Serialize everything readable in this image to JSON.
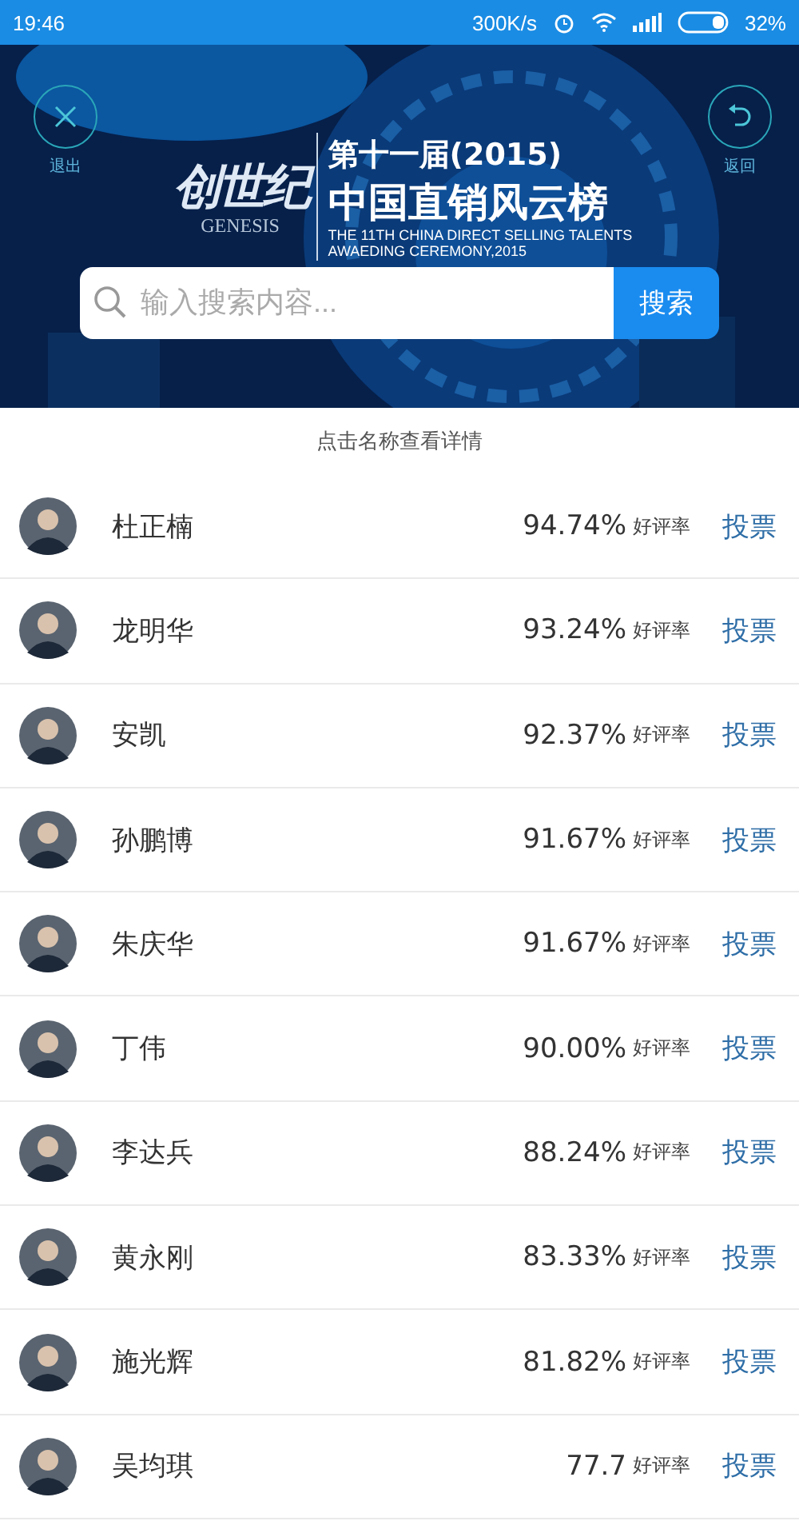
{
  "status_bar": {
    "time": "19:46",
    "speed": "300K/s",
    "battery": "32%"
  },
  "banner": {
    "exit_label": "退出",
    "back_label": "返回",
    "logo_cn": "创世纪",
    "logo_en": "GENESIS",
    "edition": "第十一届(2015)",
    "title": "中国直销风云榜",
    "subtitle_1": "THE 11TH CHINA DIRECT SELLING TALENTS",
    "subtitle_2": "AWAEDING CEREMONY,2015",
    "search": {
      "placeholder": "输入搜索内容...",
      "button": "搜索"
    }
  },
  "hint": "点击名称查看详情",
  "rows": [
    {
      "name": "杜正楠",
      "rate": "94.74%",
      "rate_label": "好评率",
      "vote": "投票"
    },
    {
      "name": "龙明华",
      "rate": "93.24%",
      "rate_label": "好评率",
      "vote": "投票"
    },
    {
      "name": "安凯",
      "rate": "92.37%",
      "rate_label": "好评率",
      "vote": "投票"
    },
    {
      "name": "孙鹏博",
      "rate": "91.67%",
      "rate_label": "好评率",
      "vote": "投票"
    },
    {
      "name": "朱庆华",
      "rate": "91.67%",
      "rate_label": "好评率",
      "vote": "投票"
    },
    {
      "name": "丁伟",
      "rate": "90.00%",
      "rate_label": "好评率",
      "vote": "投票"
    },
    {
      "name": "李达兵",
      "rate": "88.24%",
      "rate_label": "好评率",
      "vote": "投票"
    },
    {
      "name": "黄永刚",
      "rate": "83.33%",
      "rate_label": "好评率",
      "vote": "投票"
    },
    {
      "name": "施光辉",
      "rate": "81.82%",
      "rate_label": "好评率",
      "vote": "投票"
    },
    {
      "name": "吴均琪",
      "rate": "77.7",
      "rate_label": "好评率",
      "vote": "投票"
    }
  ]
}
